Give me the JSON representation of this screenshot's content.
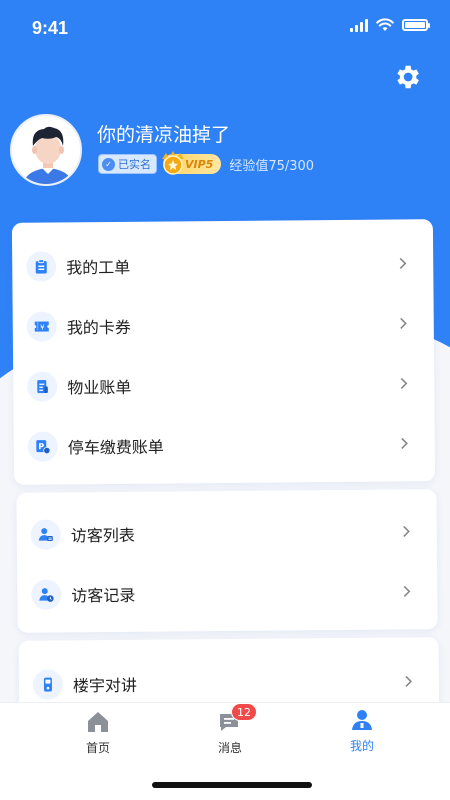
{
  "status_bar": {
    "time": "9:41"
  },
  "profile": {
    "username": "你的清凉油掉了",
    "verified_label": "已实名",
    "vip_label": "VIP5",
    "exp_label": "经验值75/300"
  },
  "menu_group_1": [
    {
      "label": "我的工单",
      "icon": "clipboard-icon"
    },
    {
      "label": "我的卡券",
      "icon": "coupon-icon"
    },
    {
      "label": "物业账单",
      "icon": "bill-icon"
    },
    {
      "label": "停车缴费账单",
      "icon": "parking-icon"
    }
  ],
  "menu_group_2": [
    {
      "label": "访客列表",
      "icon": "visitor-list-icon"
    },
    {
      "label": "访客记录",
      "icon": "visitor-record-icon"
    }
  ],
  "menu_group_3": [
    {
      "label": "楼宇对讲",
      "icon": "intercom-icon"
    }
  ],
  "tabbar": {
    "tabs": [
      {
        "label": "首页",
        "icon": "home-icon",
        "active": false
      },
      {
        "label": "消息",
        "icon": "message-icon",
        "active": false,
        "badge": "12"
      },
      {
        "label": "我的",
        "icon": "user-icon",
        "active": true
      }
    ]
  },
  "colors": {
    "primary": "#2f82f6",
    "badge": "#f24a4a",
    "background": "#f4f6fa"
  }
}
